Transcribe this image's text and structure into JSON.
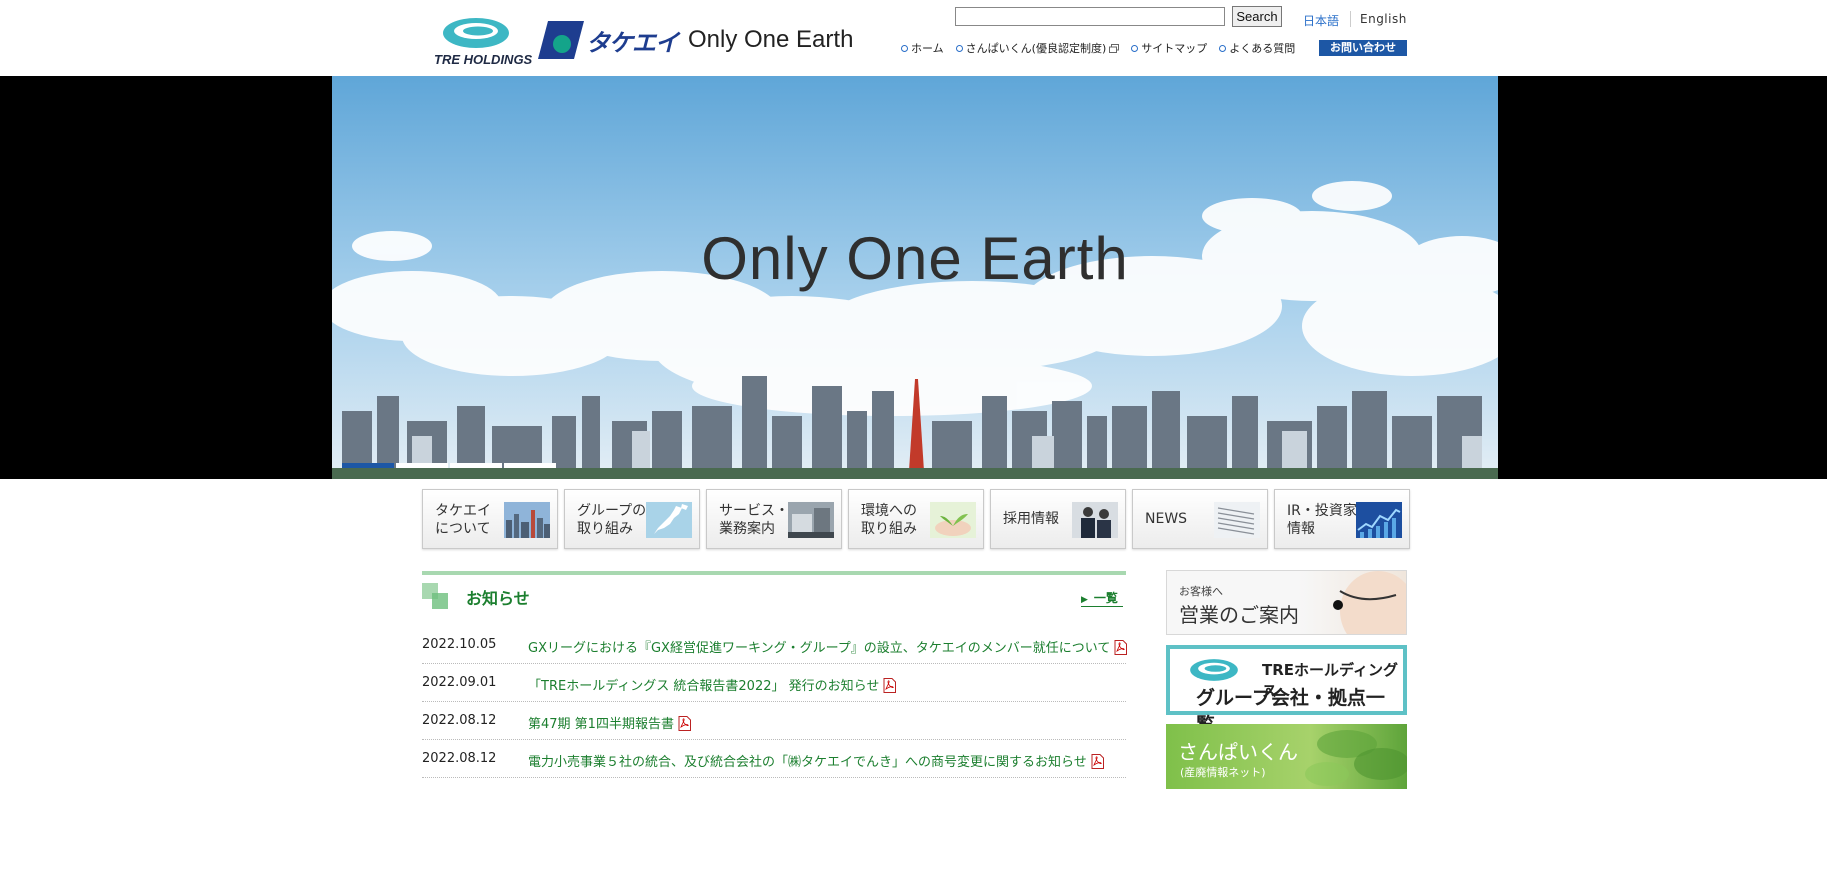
{
  "header": {
    "tre_logo_text": "TRE HOLDINGS",
    "takeei_logo_kana": "タケエイ",
    "tagline": "Only One Earth",
    "search": {
      "value": "",
      "placeholder": "",
      "button_label": "Search"
    },
    "languages": [
      "日本語",
      "English"
    ],
    "util_nav": [
      {
        "label": "ホーム"
      },
      {
        "label": "さんぱいくん(優良認定制度)",
        "external": true
      },
      {
        "label": "サイトマップ"
      },
      {
        "label": "よくある質問"
      }
    ],
    "contact_label": "お問い合わせ"
  },
  "hero": {
    "title": "Only One Earth",
    "slides_total": 4,
    "active_slide": 1
  },
  "main_nav": [
    {
      "label": "タケエイ\nについて",
      "icon": "city-skyline-thumb"
    },
    {
      "label": "グループの\n取り組み",
      "icon": "japan-map-thumb"
    },
    {
      "label": "サービス・\n業務案内",
      "icon": "facility-thumb"
    },
    {
      "label": "環境への\n取り組み",
      "icon": "sprout-hands-thumb"
    },
    {
      "label": "採用情報",
      "icon": "staff-thumb"
    },
    {
      "label": "NEWS",
      "icon": "newspaper-thumb"
    },
    {
      "label": "IR・投資家\n情報",
      "icon": "chart-thumb"
    }
  ],
  "news": {
    "heading": "お知らせ",
    "all_link": "一覧",
    "items": [
      {
        "date": "2022.10.05",
        "title": "GXリーグにおける『GX経営促進ワーキング・グループ』の設立、タケエイのメンバー就任について",
        "pdf": true
      },
      {
        "date": "2022.09.01",
        "title": "「TREホールディングス 統合報告書2022」 発行のお知らせ",
        "pdf": true
      },
      {
        "date": "2022.08.12",
        "title": "第47期 第1四半期報告書",
        "pdf": true
      },
      {
        "date": "2022.08.12",
        "title": "電力小売事業５社の統合、及び統合会社の「㈱タケエイでんき」への商号変更に関するお知らせ",
        "pdf": true
      }
    ]
  },
  "side_banners": {
    "sales": {
      "small": "お客様へ",
      "big": "営業のご案内"
    },
    "group": {
      "line1": "TREホールディングス",
      "line2": "グループ会社・拠点一覧"
    },
    "sanpai": {
      "line1": "さんぱいくん",
      "line2": "(産廃情報ネット)"
    }
  },
  "colors": {
    "accent_blue": "#1d57a5",
    "link_green": "#1c7f2f",
    "news_bar": "#a8d8b0",
    "group_border": "#5ec1c6"
  }
}
